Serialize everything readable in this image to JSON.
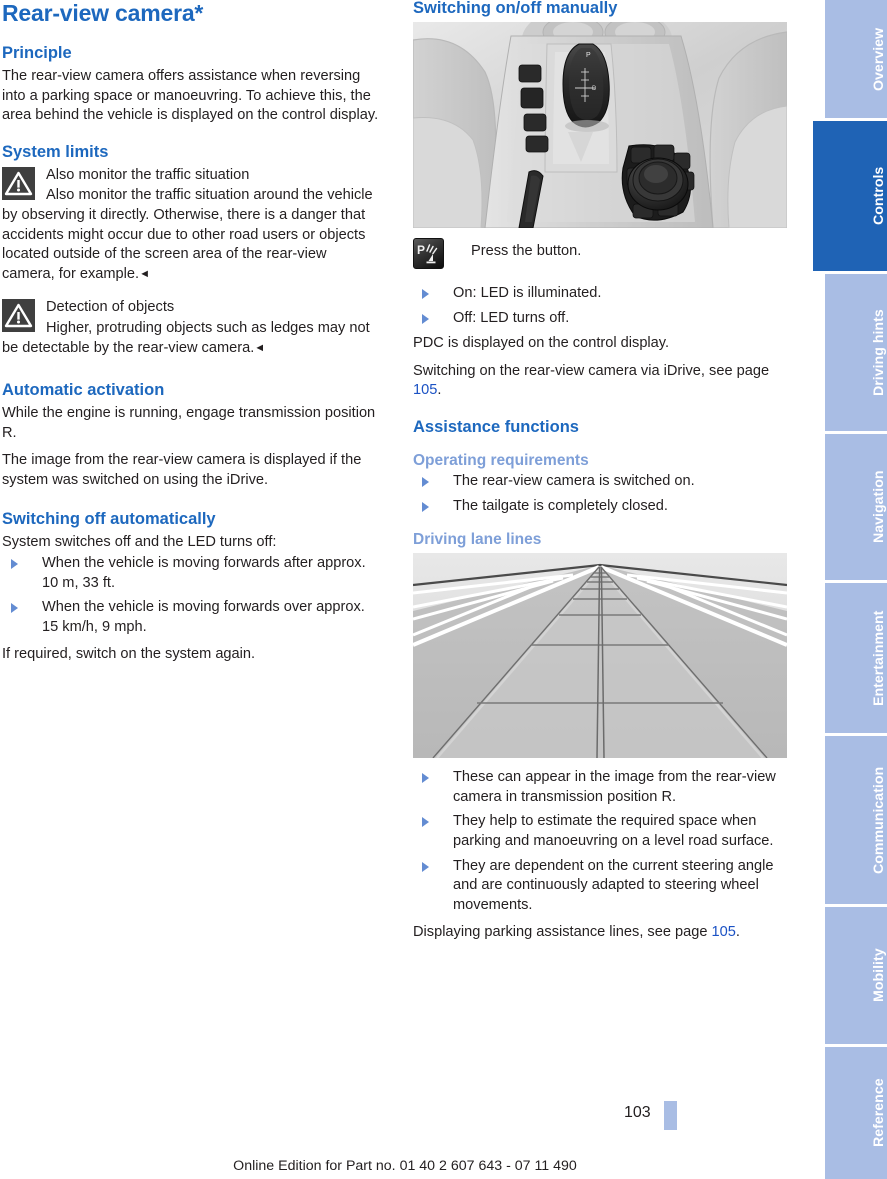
{
  "page": {
    "title": "Rear-view camera*",
    "number": "103",
    "footer": "Online Edition for Part no. 01 40 2 607 643 - 07 11 490"
  },
  "colors": {
    "heading_blue": "#1d68be",
    "subheading_blue": "#7e9fd8",
    "tab_inactive": "#a9bde4",
    "tab_active": "#1f63b5",
    "link_blue": "#1b52c4",
    "warning_icon_bg": "#3f3f3f"
  },
  "left_column": {
    "principle": {
      "heading": "Principle",
      "text": "The rear-view camera offers assistance when reversing into a parking space or manoeuvring. To achieve this, the area behind the vehicle is displayed on the control display."
    },
    "system_limits": {
      "heading": "System limits",
      "warnings": [
        {
          "icon": "warning-triangle-icon",
          "title": "Also monitor the traffic situation",
          "body": "Also monitor the traffic situation around the vehicle by observing it directly. Otherwise, there is a danger that accidents might occur due to other road users or objects located outside of the screen area of the rear-view camera, for example.",
          "endmark": "◄"
        },
        {
          "icon": "warning-triangle-icon",
          "title": "Detection of objects",
          "body": "Higher, protruding objects such as ledges may not be detectable by the rear-view camera.",
          "endmark": "◄"
        }
      ]
    },
    "automatic_activation": {
      "heading": "Automatic activation",
      "paragraph_1": "While the engine is running, engage transmission position R.",
      "paragraph_2": "The image from the rear-view camera is displayed if the system was switched on using the iDrive."
    },
    "switching_off": {
      "heading": "Switching off automatically",
      "intro": "System switches off and the LED turns off:",
      "bullets": [
        "When the vehicle is moving forwards after approx. 10 m, 33 ft.",
        "When the vehicle is moving forwards over approx. 15 km/h, 9 mph."
      ],
      "closing": "If required, switch on the system again."
    }
  },
  "right_column": {
    "switching_manually": {
      "heading": "Switching on/off manually",
      "figure_alt": "center-console-illustration",
      "button_icon": "pdc-button-icon",
      "button_label": "Press the button.",
      "bullets": [
        "On: LED is illuminated.",
        "Off: LED turns off."
      ],
      "paragraph_1": "PDC is displayed on the control display.",
      "paragraph_2_pre": "Switching on the rear-view camera via iDrive, see page ",
      "paragraph_2_page": "105",
      "paragraph_2_post": "."
    },
    "assistance_functions": {
      "heading": "Assistance functions",
      "operating_requirements": {
        "heading": "Operating requirements",
        "bullets": [
          "The rear-view camera is switched on.",
          "The tailgate is completely closed."
        ]
      },
      "driving_lane_lines": {
        "heading": "Driving lane lines",
        "figure_alt": "driving-lane-lines-perspective-illustration",
        "bullets": [
          "These can appear in the image from the rear-view camera in transmission position R.",
          "They help to estimate the required space when parking and manoeuvring on a level road surface.",
          "They are dependent on the current steering angle and are continuously adapted to steering wheel movements."
        ],
        "closing_pre": "Displaying parking assistance lines, see page ",
        "closing_page": "105",
        "closing_post": "."
      }
    }
  },
  "sidebar": {
    "tabs": [
      {
        "label": "Overview",
        "active": false
      },
      {
        "label": "Controls",
        "active": true
      },
      {
        "label": "Driving hints",
        "active": false
      },
      {
        "label": "Navigation",
        "active": false
      },
      {
        "label": "Entertainment",
        "active": false
      },
      {
        "label": "Communication",
        "active": false
      },
      {
        "label": "Mobility",
        "active": false
      },
      {
        "label": "Reference",
        "active": false
      }
    ]
  }
}
